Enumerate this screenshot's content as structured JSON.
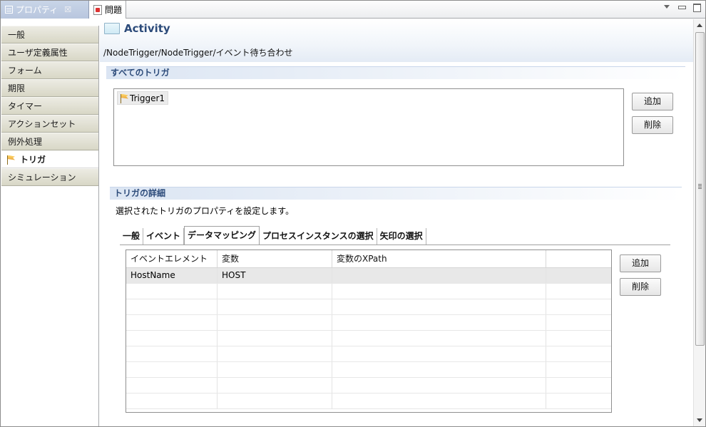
{
  "view_tabs": [
    {
      "label": "プロパティ",
      "close": "☒"
    },
    {
      "label": "問題"
    }
  ],
  "sidebar": {
    "items": [
      {
        "label": "一般"
      },
      {
        "label": "ユーザ定義属性"
      },
      {
        "label": "フォーム"
      },
      {
        "label": "期限"
      },
      {
        "label": "タイマー"
      },
      {
        "label": "アクションセット"
      },
      {
        "label": "例外処理"
      },
      {
        "label": "トリガ",
        "selected": true
      },
      {
        "label": "シミュレーション"
      }
    ]
  },
  "header": {
    "title": "Activity",
    "path": "/NodeTrigger/NodeTrigger/イベント待ち合わせ"
  },
  "all_triggers": {
    "section_title": "すべてのトリガ",
    "items": [
      "Trigger1"
    ],
    "add_label": "追加",
    "delete_label": "削除"
  },
  "trigger_details": {
    "section_title": "トリガの詳細",
    "description": "選択されたトリガのプロパティを設定します。",
    "tabs": [
      {
        "label": "一般"
      },
      {
        "label": "イベント"
      },
      {
        "label": "データマッピング",
        "active": true
      },
      {
        "label": "プロセスインスタンスの選択"
      },
      {
        "label": "矢印の選択"
      }
    ],
    "table": {
      "columns": [
        "イベントエレメント",
        "変数",
        "変数のXPath",
        ""
      ],
      "rows": [
        [
          "HostName",
          "HOST",
          "",
          ""
        ]
      ],
      "empty_rows": 8
    },
    "add_label": "追加",
    "delete_label": "削除"
  }
}
